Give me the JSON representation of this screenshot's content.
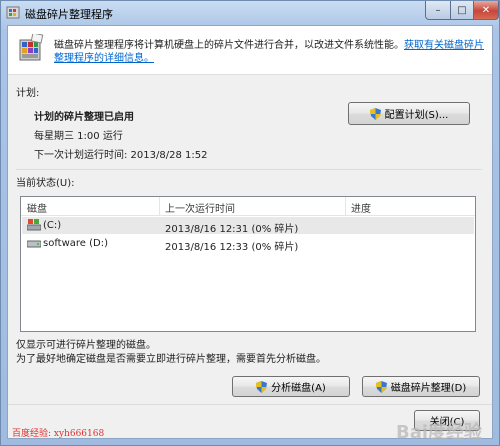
{
  "window": {
    "title": "磁盘碎片整理程序",
    "controls": {
      "minimize": "–",
      "maximize": "□",
      "close": "✕"
    }
  },
  "header": {
    "description": "磁盘碎片整理程序将计算机硬盘上的碎片文件进行合并，以改进文件系统性能。",
    "link": "获取有关磁盘碎片整理程序的详细信息。"
  },
  "schedule": {
    "section_label": "计划:",
    "status": "计划的碎片整理已启用",
    "frequency": "每星期三  1:00 运行",
    "next_run": "下一次计划运行时间: 2013/8/28 1:52",
    "configure_button": "配置计划(S)..."
  },
  "current_status": {
    "section_label": "当前状态(U):",
    "columns": [
      "磁盘",
      "上一次运行时间",
      "进度"
    ],
    "rows": [
      {
        "disk": "(C:)",
        "last_run": "2013/8/16 12:31 (0% 碎片)",
        "progress": "",
        "icon": "os-drive-icon",
        "selected": true
      },
      {
        "disk": "software (D:)",
        "last_run": "2013/8/16 12:33 (0% 碎片)",
        "progress": "",
        "icon": "hard-drive-icon",
        "selected": false
      }
    ]
  },
  "footer": {
    "note1": "仅显示可进行碎片整理的磁盘。",
    "note2": "为了最好地确定磁盘是否需要立即进行碎片整理，需要首先分析磁盘。",
    "analyze_button": "分析磁盘(A)",
    "defrag_button": "磁盘碎片整理(D)",
    "close_button": "关闭(C)"
  },
  "watermark": {
    "left_text": "百度经验: xyh666168",
    "right_text": "Bai度经验"
  },
  "colors": {
    "link": "#0066cc",
    "watermark_red": "#e03030",
    "title_gradient_top": "#c9dcf2"
  }
}
